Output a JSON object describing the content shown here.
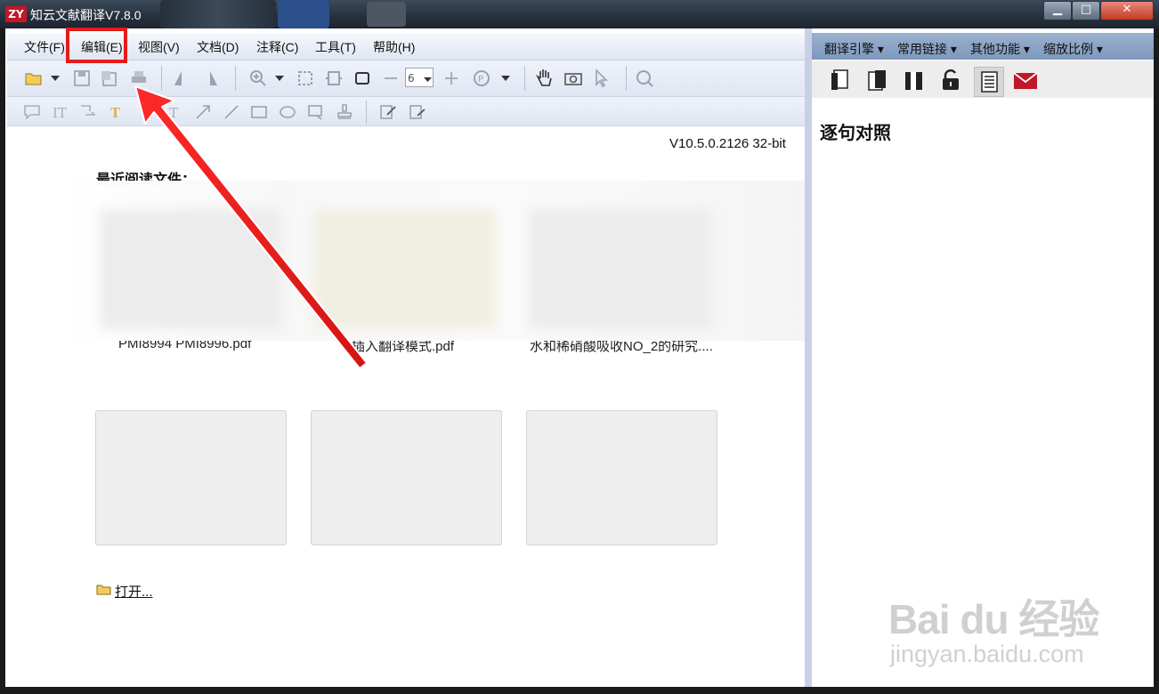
{
  "window": {
    "logo": "ZY",
    "title": "知云文献翻译V7.8.0",
    "min": "▁",
    "max": "□",
    "close": "✕"
  },
  "menu": [
    "文件(F)",
    "编辑(E)",
    "视图(V)",
    "文档(D)",
    "注释(C)",
    "工具(T)",
    "帮助(H)"
  ],
  "toolbar": {
    "page_number": "6"
  },
  "main": {
    "version": "V10.5.0.2126 32-bit",
    "recent_title": "最近阅读文件：",
    "recent_files": [
      "PMI8994 PMI8996.pdf",
      "插入翻译模式.pdf",
      "水和稀硝酸吸收NO_2的研究...."
    ],
    "open_label": "打开..."
  },
  "right": {
    "menu": [
      "翻译引擎",
      "常用链接",
      "其他功能",
      "缩放比例"
    ],
    "title": "逐句对照"
  },
  "watermark": {
    "logo": "Bai du 经验",
    "url": "jingyan.baidu.com"
  },
  "colors": {
    "accent_red": "#e51b1b",
    "right_menu_bg": "#8aa4c6"
  }
}
